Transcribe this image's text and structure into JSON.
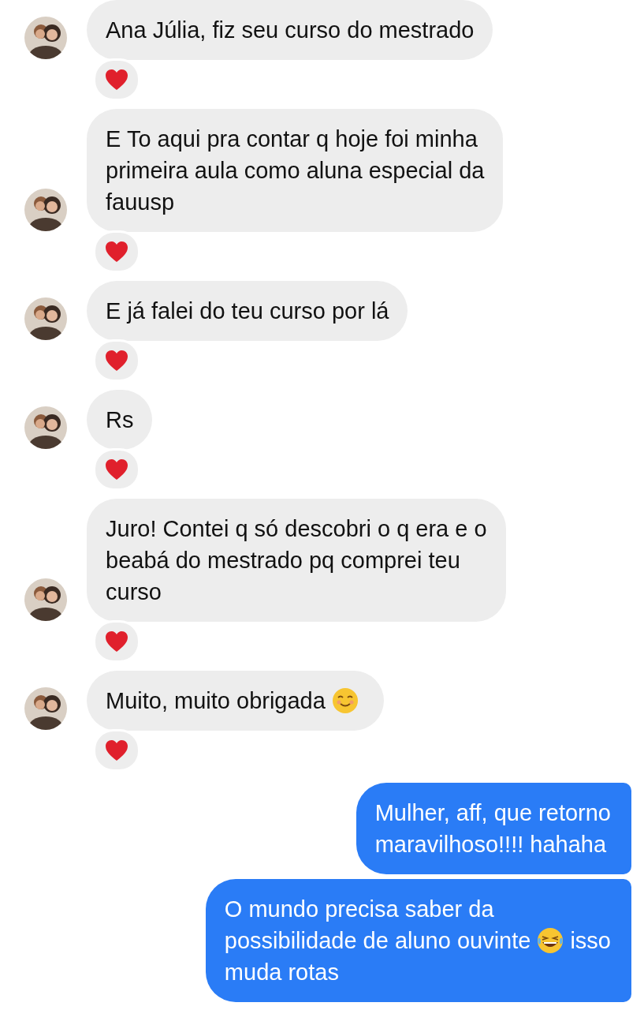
{
  "messages": [
    {
      "outgoing": false,
      "hearted": true,
      "lines": [
        [
          {
            "kind": "text",
            "text": "Ana Júlia, fiz seu curso do mestrado"
          }
        ]
      ]
    },
    {
      "outgoing": false,
      "hearted": true,
      "lines": [
        [
          {
            "kind": "text",
            "text": "E To aqui pra contar q hoje foi minha"
          }
        ],
        [
          {
            "kind": "text",
            "text": "primeira aula como aluna especial da"
          }
        ],
        [
          {
            "kind": "text",
            "text": "fauusp"
          }
        ]
      ]
    },
    {
      "outgoing": false,
      "hearted": true,
      "lines": [
        [
          {
            "kind": "text",
            "text": "E já falei do teu curso por lá"
          }
        ]
      ]
    },
    {
      "outgoing": false,
      "hearted": true,
      "lines": [
        [
          {
            "kind": "text",
            "text": "Rs"
          }
        ]
      ]
    },
    {
      "outgoing": false,
      "hearted": true,
      "lines": [
        [
          {
            "kind": "text",
            "text": "Juro! Contei q só descobri o q era e o"
          }
        ],
        [
          {
            "kind": "text",
            "text": "beabá do mestrado pq comprei teu"
          }
        ],
        [
          {
            "kind": "text",
            "text": "curso"
          }
        ]
      ]
    },
    {
      "outgoing": false,
      "hearted": true,
      "lines": [
        [
          {
            "kind": "text",
            "text": "Muito, muito obrigada"
          },
          {
            "kind": "smiley"
          }
        ]
      ]
    },
    {
      "outgoing": true,
      "hearted": false,
      "lines": [
        [
          {
            "kind": "text",
            "text": "Mulher, aff, que retorno"
          }
        ],
        [
          {
            "kind": "text",
            "text": "maravilhoso!!!! hahaha"
          }
        ]
      ]
    },
    {
      "outgoing": true,
      "hearted": false,
      "lines": [
        [
          {
            "kind": "text",
            "text": "O mundo precisa saber da"
          }
        ],
        [
          {
            "kind": "text",
            "text": "possibilidade de aluno ouvinte"
          },
          {
            "kind": "laughing"
          },
          {
            "kind": "text",
            "text": "isso"
          }
        ],
        [
          {
            "kind": "text",
            "text": "muda rotas"
          }
        ]
      ]
    }
  ]
}
